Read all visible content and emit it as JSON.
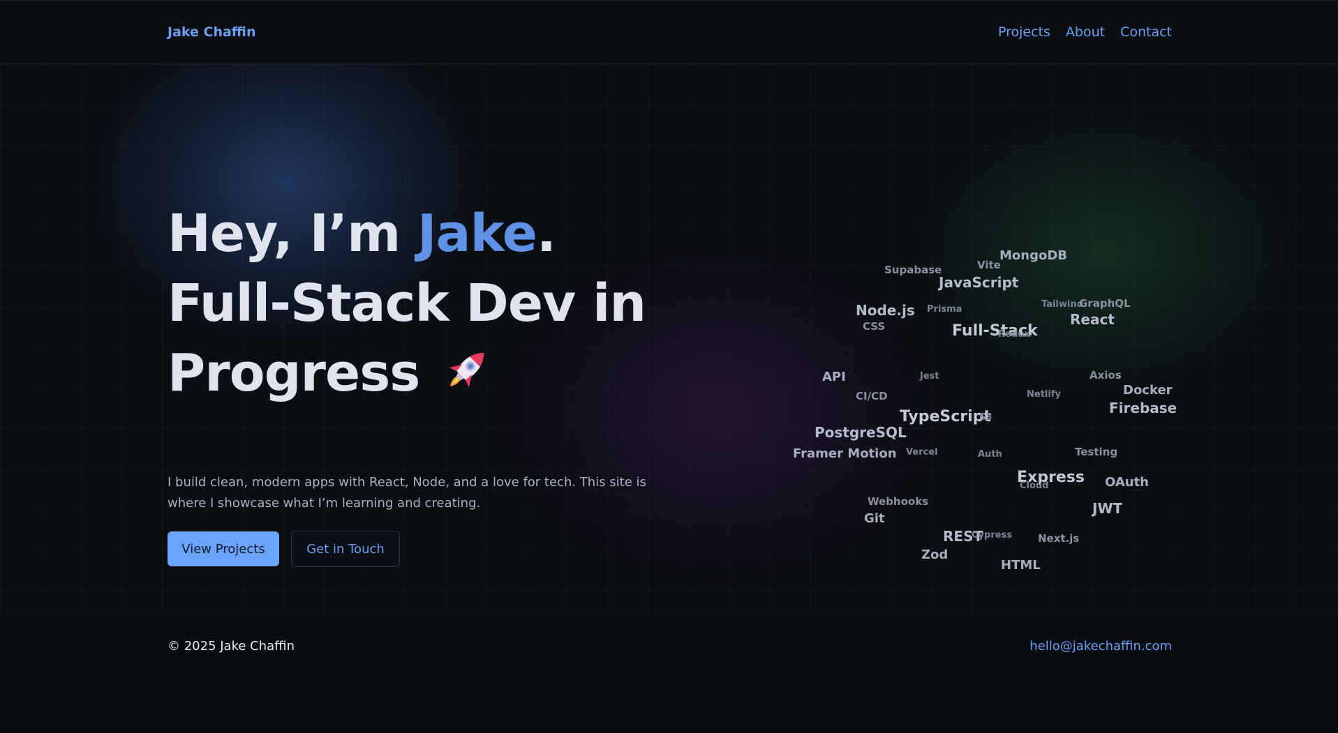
{
  "header": {
    "brand": "Jake Chaffin",
    "nav": [
      {
        "label": "Projects"
      },
      {
        "label": "About"
      },
      {
        "label": "Contact"
      }
    ]
  },
  "hero": {
    "line1_prefix": "Hey, I’m ",
    "line1_name": "Jake",
    "line1_suffix": ".",
    "line2": "Full-Stack Dev in",
    "line3": "Progress",
    "rocket_icon": "rocket-icon",
    "intro": "I build clean, modern apps with React, Node, and a love for tech. This site is where I showcase what I’m learning and creating.",
    "primary_button": "View Projects",
    "secondary_button": "Get in Touch",
    "accent_color": "#5f92e6"
  },
  "tag_cloud": [
    "MongoDB",
    "Vite",
    "Supabase",
    "JavaScript",
    "Tailwind",
    "GraphQL",
    "Node.js",
    "Prisma",
    "React",
    "CSS",
    "Full-Stack",
    "Redux",
    "API",
    "Jest",
    "Axios",
    "CI/CD",
    "Netlify",
    "Docker",
    "TypeScript",
    "S3",
    "Firebase",
    "PostgreSQL",
    "Framer Motion",
    "Vercel",
    "Auth",
    "Testing",
    "Express",
    "Cloud",
    "OAuth",
    "Webhooks",
    "JWT",
    "Git",
    "REST",
    "Cypress",
    "Next.js",
    "Zod",
    "HTML"
  ],
  "footer": {
    "copyright": "© 2025 Jake Chaffin",
    "email": "hello@jakechaffin.com"
  }
}
